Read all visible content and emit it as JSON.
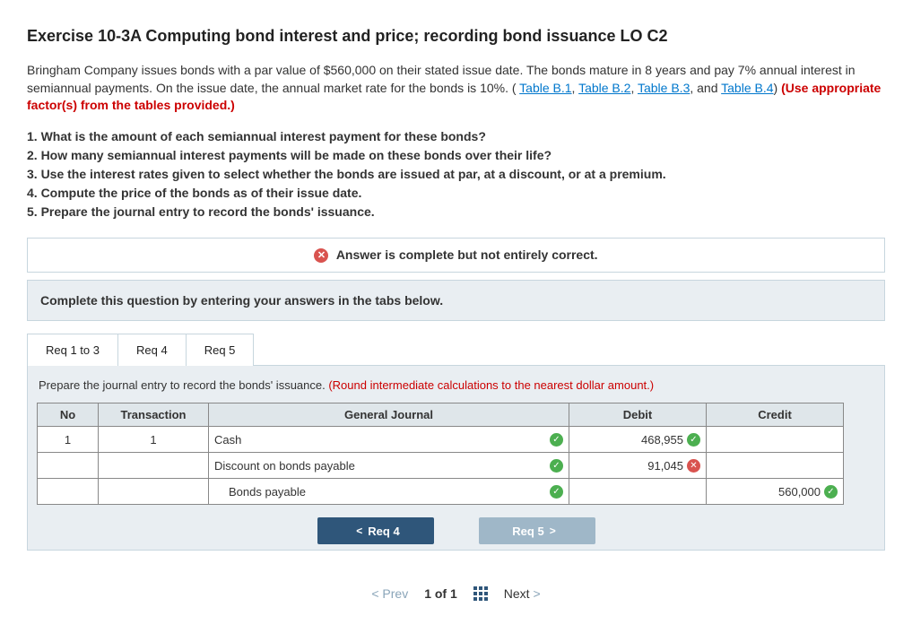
{
  "title": "Exercise 10-3A Computing bond interest and price; recording bond issuance LO C2",
  "intro": {
    "part1": "Bringham Company issues bonds with a par value of $560,000 on their stated issue date. The bonds mature in 8 years and pay 7% annual interest in semiannual payments. On the issue date, the annual market rate for the bonds is 10%. (",
    "links": [
      "Table B.1",
      "Table B.2",
      "Table B.3",
      "Table B.4"
    ],
    "sep": ", ",
    "and": ", and ",
    "close": ") ",
    "redbold": "(Use appropriate factor(s) from the tables provided.)"
  },
  "questions": {
    "q1": "1. What is the amount of each semiannual interest payment for these bonds?",
    "q2": "2. How many semiannual interest payments will be made on these bonds over their life?",
    "q3": "3. Use the interest rates given to select whether the bonds are issued at par, at a discount, or at a premium.",
    "q4": "4. Compute the price of the bonds as of their issue date.",
    "q5": "5. Prepare the journal entry to record the bonds' issuance."
  },
  "status": "Answer is complete but not entirely correct.",
  "instr": "Complete this question by entering your answers in the tabs below.",
  "tabs": {
    "t1": "Req 1 to 3",
    "t2": "Req 4",
    "t3": "Req 5"
  },
  "tabbody": {
    "lead": "Prepare the journal entry to record the bonds' issuance. ",
    "red": "(Round intermediate calculations to the nearest dollar amount.)"
  },
  "headers": {
    "no": "No",
    "tx": "Transaction",
    "gj": "General Journal",
    "debit": "Debit",
    "credit": "Credit"
  },
  "rows": [
    {
      "no": "1",
      "tx": "1",
      "acct": "Cash",
      "debit": "468,955",
      "credit": "",
      "dmark": "ok"
    },
    {
      "no": "",
      "tx": "",
      "acct": "Discount on bonds payable",
      "debit": "91,045",
      "credit": "",
      "dmark": "bad"
    },
    {
      "no": "",
      "tx": "",
      "acct": "Bonds payable",
      "indent": true,
      "debit": "",
      "credit": "560,000",
      "cmark": "ok"
    }
  ],
  "nav": {
    "prev": "Req 4",
    "next": "Req 5"
  },
  "pager": {
    "prev": "Prev",
    "pos": "1 of 1",
    "next": "Next"
  }
}
